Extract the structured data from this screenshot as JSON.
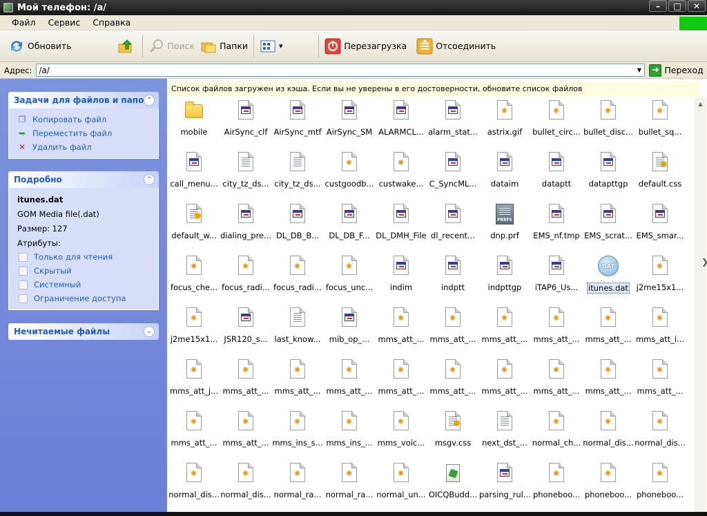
{
  "window": {
    "title": "Мой телефон: /a/",
    "controls": [
      "–",
      "□",
      "✕"
    ]
  },
  "menu": [
    "Файл",
    "Сервис",
    "Справка"
  ],
  "toolbar": {
    "refresh_label": "Обновить",
    "search_label": "Поиск",
    "folders_label": "Папки",
    "reboot_label": "Перезагрузка",
    "disconnect_label": "Отсоединить"
  },
  "address": {
    "label": "Адрес:",
    "value": "/a/",
    "go_label": "Переход"
  },
  "tasks_panel": {
    "title": "Задачи для файлов и папок",
    "items": [
      "Копировать файл",
      "Переместить файл",
      "Удалить файл"
    ]
  },
  "details_panel": {
    "title": "Подробно",
    "name": "itunes.dat",
    "type": "GOM Media file(.dat)",
    "size": "Размер: 127",
    "attributes_label": "Атрибуты:",
    "attributes": [
      "Только для чтения",
      "Скрытый",
      "Системный",
      "Ограничение доступа"
    ]
  },
  "unreadable_panel": {
    "title": "Нечитаемые файлы"
  },
  "infobar": "Список файлов загружен из кэша. Если вы не уверены в его достоверности, обновите список файлов",
  "files": [
    {
      "name": "mobile",
      "icon": "folder"
    },
    {
      "name": "AirSync_clf",
      "icon": "app"
    },
    {
      "name": "AirSync_mtf",
      "icon": "app"
    },
    {
      "name": "AirSync_SM",
      "icon": "app"
    },
    {
      "name": "ALARMCL...",
      "icon": "app"
    },
    {
      "name": "alarm_stat...",
      "icon": "app"
    },
    {
      "name": "astrix.gif",
      "icon": "image"
    },
    {
      "name": "bullet_circ...",
      "icon": "image"
    },
    {
      "name": "bullet_disc...",
      "icon": "image"
    },
    {
      "name": "bullet_sq...",
      "icon": "image"
    },
    {
      "name": "call_menu...",
      "icon": "app"
    },
    {
      "name": "city_tz_ds...",
      "icon": "text"
    },
    {
      "name": "city_tz_ds...",
      "icon": "text"
    },
    {
      "name": "custgoodb...",
      "icon": "image"
    },
    {
      "name": "custwake...",
      "icon": "image"
    },
    {
      "name": "C_SyncML...",
      "icon": "app"
    },
    {
      "name": "dataim",
      "icon": "app"
    },
    {
      "name": "dataptt",
      "icon": "app"
    },
    {
      "name": "datapttgp",
      "icon": "app"
    },
    {
      "name": "default.css",
      "icon": "css"
    },
    {
      "name": "default_w...",
      "icon": "css"
    },
    {
      "name": "dialing_pre...",
      "icon": "app"
    },
    {
      "name": "DL_DB_B...",
      "icon": "app"
    },
    {
      "name": "DL_DB_F...",
      "icon": "app"
    },
    {
      "name": "DL_DMH_File",
      "icon": "app"
    },
    {
      "name": "dl_recent...",
      "icon": "app"
    },
    {
      "name": "dnp.prf",
      "icon": "prefs"
    },
    {
      "name": "EMS_nf.tmp",
      "icon": "app"
    },
    {
      "name": "EMS_scrat...",
      "icon": "app"
    },
    {
      "name": "EMS_smar...",
      "icon": "app"
    },
    {
      "name": "focus_che...",
      "icon": "image"
    },
    {
      "name": "focus_radi...",
      "icon": "image"
    },
    {
      "name": "focus_radi...",
      "icon": "image"
    },
    {
      "name": "focus_unc...",
      "icon": "image"
    },
    {
      "name": "indim",
      "icon": "app"
    },
    {
      "name": "indptt",
      "icon": "app"
    },
    {
      "name": "indpttgp",
      "icon": "app"
    },
    {
      "name": "iTAP6_Us...",
      "icon": "app"
    },
    {
      "name": "itunes.dat",
      "icon": "dat",
      "selected": true
    },
    {
      "name": "j2me15x1...",
      "icon": "image"
    },
    {
      "name": "j2me15x1...",
      "icon": "image"
    },
    {
      "name": "JSR120_s...",
      "icon": "app"
    },
    {
      "name": "last_know...",
      "icon": "text"
    },
    {
      "name": "mib_op_...",
      "icon": "app"
    },
    {
      "name": "mms_att_...",
      "icon": "image"
    },
    {
      "name": "mms_att_...",
      "icon": "image"
    },
    {
      "name": "mms_att_...",
      "icon": "image"
    },
    {
      "name": "mms_att_...",
      "icon": "image"
    },
    {
      "name": "mms_att_...",
      "icon": "image"
    },
    {
      "name": "mms_att_i...",
      "icon": "image"
    },
    {
      "name": "mms_att_j...",
      "icon": "image"
    },
    {
      "name": "mms_att_...",
      "icon": "image"
    },
    {
      "name": "mms_att_...",
      "icon": "image"
    },
    {
      "name": "mms_att_...",
      "icon": "image"
    },
    {
      "name": "mms_att_...",
      "icon": "image"
    },
    {
      "name": "mms_att_...",
      "icon": "image"
    },
    {
      "name": "mms_att_...",
      "icon": "image"
    },
    {
      "name": "mms_att_...",
      "icon": "image"
    },
    {
      "name": "mms_att_...",
      "icon": "image"
    },
    {
      "name": "mms_att_...",
      "icon": "image"
    },
    {
      "name": "mms_att_...",
      "icon": "image"
    },
    {
      "name": "mms_att_...",
      "icon": "image"
    },
    {
      "name": "mms_ins_s...",
      "icon": "image"
    },
    {
      "name": "mms_ins_...",
      "icon": "image"
    },
    {
      "name": "mms_voic...",
      "icon": "image"
    },
    {
      "name": "msgv.css",
      "icon": "css"
    },
    {
      "name": "next_dst_...",
      "icon": "text"
    },
    {
      "name": "normal_ch...",
      "icon": "image"
    },
    {
      "name": "normal_dis...",
      "icon": "image"
    },
    {
      "name": "normal_dis...",
      "icon": "image"
    },
    {
      "name": "normal_dis...",
      "icon": "image"
    },
    {
      "name": "normal_dis...",
      "icon": "image"
    },
    {
      "name": "normal_ra...",
      "icon": "image"
    },
    {
      "name": "normal_ra...",
      "icon": "image"
    },
    {
      "name": "normal_un...",
      "icon": "image"
    },
    {
      "name": "OICQBudd...",
      "icon": "js"
    },
    {
      "name": "parsing_rul...",
      "icon": "app"
    },
    {
      "name": "phoneboo...",
      "icon": "image"
    },
    {
      "name": "phoneboo...",
      "icon": "image"
    },
    {
      "name": "phoneboo...",
      "icon": "image"
    }
  ],
  "icon_names": {
    "folder": "folder-icon",
    "app": "application-file-icon",
    "image": "image-file-icon",
    "text": "text-file-icon",
    "css": "stylesheet-file-icon",
    "prefs": "prefs-file-icon",
    "dat": "dat-file-icon",
    "js": "script-file-icon"
  },
  "prefs_badge": "PREFS",
  "dat_badge": "DAT"
}
